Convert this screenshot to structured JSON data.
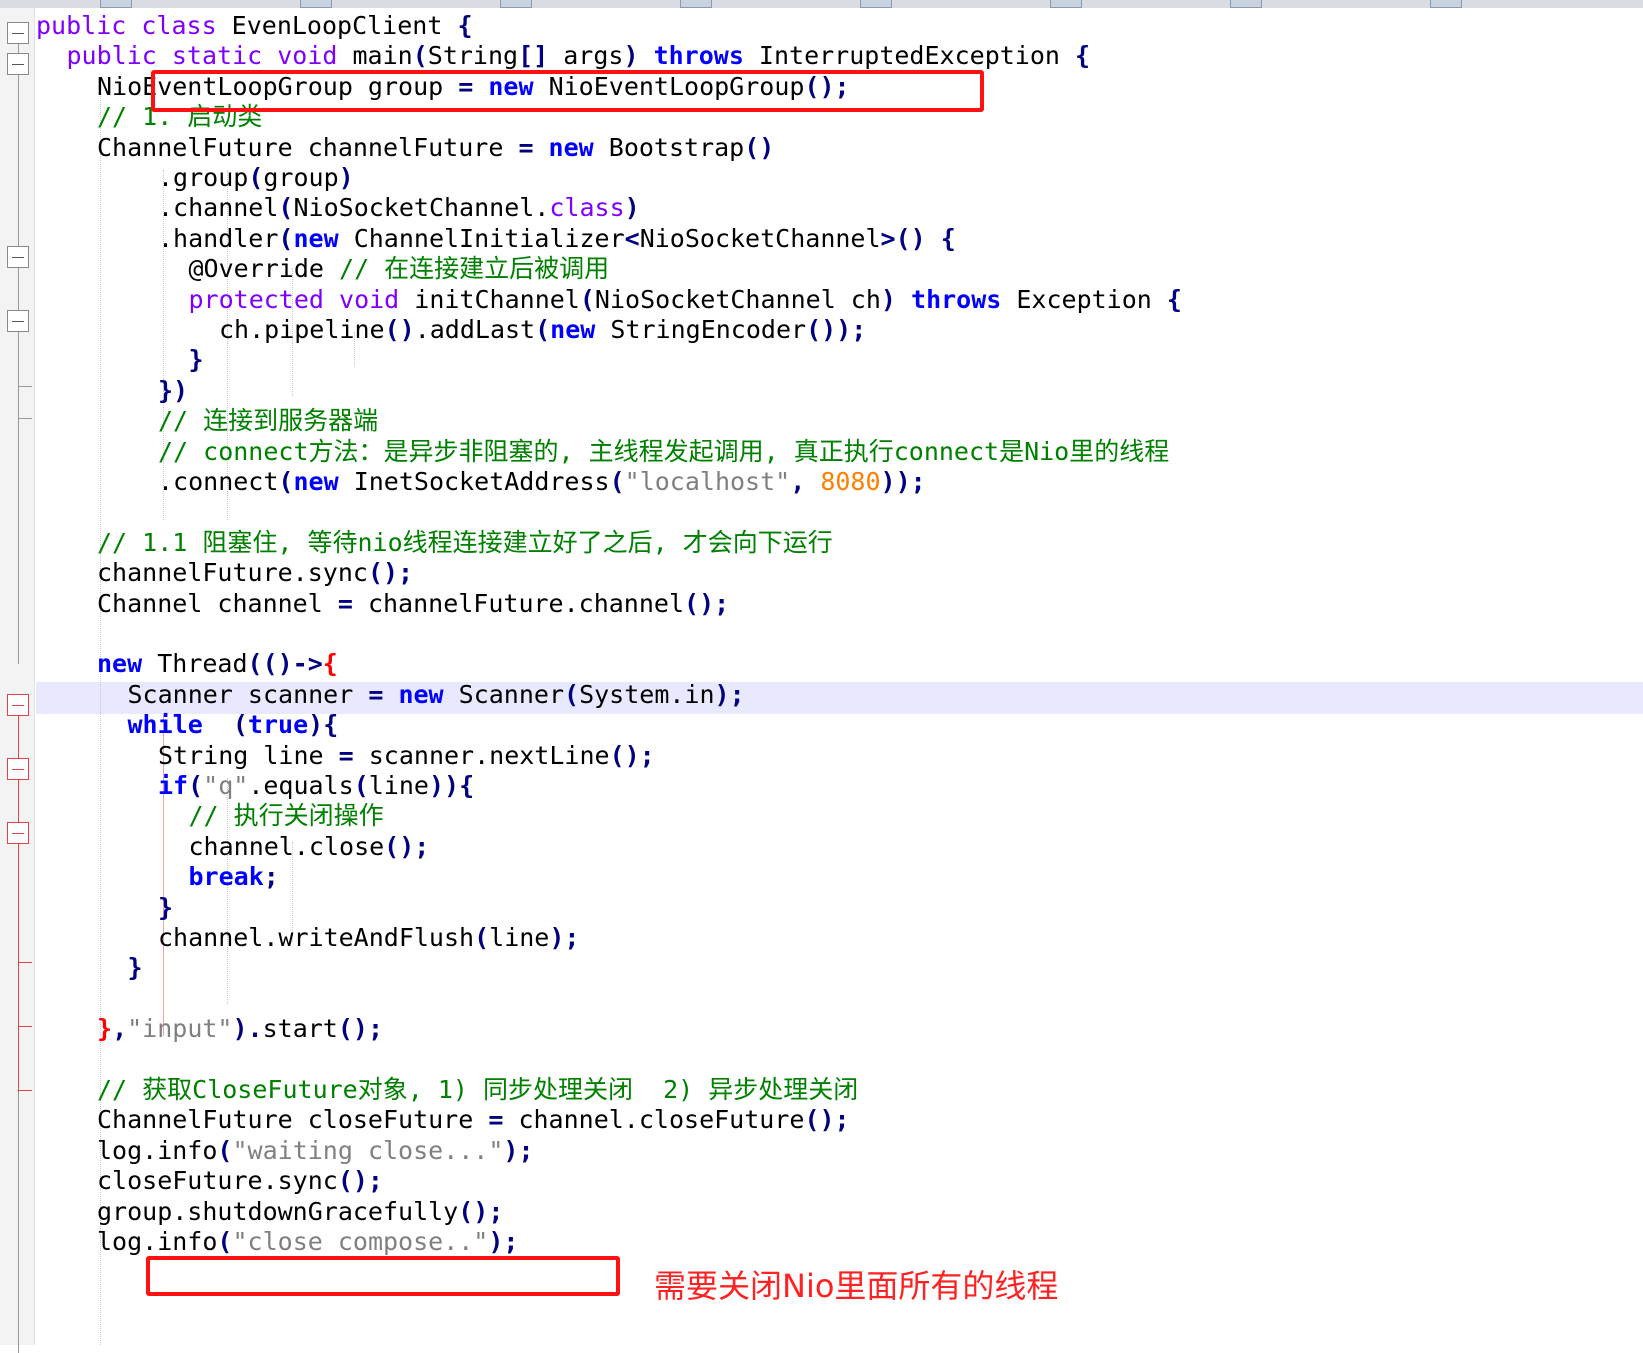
{
  "editor": {
    "language": "Java",
    "highlighted_line": 22,
    "lines": [
      [
        [
          "pk",
          "public class "
        ],
        [
          "t",
          "EvenLoopClient "
        ],
        [
          "op",
          "{"
        ]
      ],
      [
        [
          "pk",
          "public static void "
        ],
        [
          "t",
          "main"
        ],
        [
          "op",
          "("
        ],
        [
          "t",
          "String"
        ],
        [
          "op",
          "[] "
        ],
        [
          "t",
          "args"
        ],
        [
          "op",
          ") "
        ],
        [
          "kw",
          "throws "
        ],
        [
          "t",
          "InterruptedException "
        ],
        [
          "op",
          "{"
        ]
      ],
      [
        [
          "t",
          "NioEventLoopGroup group "
        ],
        [
          "op",
          "= "
        ],
        [
          "kw",
          "new "
        ],
        [
          "t",
          "NioEventLoopGroup"
        ],
        [
          "op",
          "();"
        ]
      ],
      [
        [
          "cm",
          "// 1. 启动类"
        ]
      ],
      [
        [
          "t",
          "ChannelFuture channelFuture "
        ],
        [
          "op",
          "= "
        ],
        [
          "kw",
          "new "
        ],
        [
          "t",
          "Bootstrap"
        ],
        [
          "op",
          "()"
        ]
      ],
      [
        [
          "t",
          ".group"
        ],
        [
          "op",
          "("
        ],
        [
          "t",
          "group"
        ],
        [
          "op",
          ")"
        ]
      ],
      [
        [
          "t",
          ".channel"
        ],
        [
          "op",
          "("
        ],
        [
          "t",
          "NioSocketChannel."
        ],
        [
          "pk",
          "class"
        ],
        [
          "op",
          ")"
        ]
      ],
      [
        [
          "t",
          ".handler"
        ],
        [
          "op",
          "("
        ],
        [
          "kw",
          "new "
        ],
        [
          "t",
          "ChannelInitializer"
        ],
        [
          "op",
          "<"
        ],
        [
          "t",
          "NioSocketChannel"
        ],
        [
          "op",
          ">() {"
        ]
      ],
      [
        [
          "t",
          "@Override "
        ],
        [
          "cm",
          "// 在连接建立后被调用"
        ]
      ],
      [
        [
          "pk",
          "protected void "
        ],
        [
          "t",
          "initChannel"
        ],
        [
          "op",
          "("
        ],
        [
          "t",
          "NioSocketChannel ch"
        ],
        [
          "op",
          ") "
        ],
        [
          "kw",
          "throws "
        ],
        [
          "t",
          "Exception "
        ],
        [
          "op",
          "{"
        ]
      ],
      [
        [
          "t",
          "ch.pipeline"
        ],
        [
          "op",
          "()"
        ],
        [
          "t",
          ".addLast"
        ],
        [
          "op",
          "("
        ],
        [
          "kw",
          "new "
        ],
        [
          "t",
          "StringEncoder"
        ],
        [
          "op",
          "());"
        ]
      ],
      [
        [
          "op",
          "}"
        ]
      ],
      [
        [
          "op",
          "})"
        ]
      ],
      [
        [
          "cm",
          "// 连接到服务器端"
        ]
      ],
      [
        [
          "cm",
          "// connect方法：是异步非阻塞的, 主线程发起调用, 真正执行connect是Nio里的线程"
        ]
      ],
      [
        [
          "t",
          ".connect"
        ],
        [
          "op",
          "("
        ],
        [
          "kw",
          "new "
        ],
        [
          "t",
          "InetSocketAddress"
        ],
        [
          "op",
          "("
        ],
        [
          "st",
          "\"localhost\""
        ],
        [
          "op",
          ", "
        ],
        [
          "nm",
          "8080"
        ],
        [
          "op",
          "));"
        ]
      ],
      [],
      [
        [
          "cm",
          "// 1.1 阻塞住, 等待nio线程连接建立好了之后, 才会向下运行"
        ]
      ],
      [
        [
          "t",
          "channelFuture.sync"
        ],
        [
          "op",
          "();"
        ]
      ],
      [
        [
          "t",
          "Channel channel "
        ],
        [
          "op",
          "= "
        ],
        [
          "t",
          "channelFuture.channel"
        ],
        [
          "op",
          "();"
        ]
      ],
      [],
      [
        [
          "kw",
          "new "
        ],
        [
          "t",
          "Thread"
        ],
        [
          "op",
          "(()->"
        ],
        [
          "rb",
          "{"
        ]
      ],
      [
        [
          "t",
          "Scanner scanner "
        ],
        [
          "op",
          "= "
        ],
        [
          "kw",
          "new "
        ],
        [
          "t",
          "Scanner"
        ],
        [
          "op",
          "("
        ],
        [
          "t",
          "System.in"
        ],
        [
          "op",
          ");"
        ]
      ],
      [
        [
          "kw",
          "while  "
        ],
        [
          "op",
          "("
        ],
        [
          "kw",
          "true"
        ],
        [
          "op",
          "){"
        ]
      ],
      [
        [
          "t",
          "String line "
        ],
        [
          "op",
          "= "
        ],
        [
          "t",
          "scanner.nextLine"
        ],
        [
          "op",
          "();"
        ]
      ],
      [
        [
          "kw",
          "if"
        ],
        [
          "op",
          "("
        ],
        [
          "st",
          "\"q\""
        ],
        [
          "t",
          ".equals"
        ],
        [
          "op",
          "("
        ],
        [
          "t",
          "line"
        ],
        [
          "op",
          ")){"
        ]
      ],
      [
        [
          "cm",
          "// 执行关闭操作"
        ]
      ],
      [
        [
          "t",
          "channel.close"
        ],
        [
          "op",
          "();"
        ]
      ],
      [
        [
          "kw",
          "break"
        ],
        [
          "op",
          ";"
        ]
      ],
      [
        [
          "op",
          "}"
        ]
      ],
      [
        [
          "t",
          "channel.writeAndFlush"
        ],
        [
          "op",
          "("
        ],
        [
          "t",
          "line"
        ],
        [
          "op",
          ");"
        ]
      ],
      [
        [
          "op",
          "}"
        ]
      ],
      [],
      [
        [
          "rb",
          "}"
        ],
        [
          "op",
          ","
        ],
        [
          "st",
          "\"input\""
        ],
        [
          "op",
          ")."
        ],
        [
          "t",
          "start"
        ],
        [
          "op",
          "();"
        ]
      ],
      [],
      [
        [
          "cm",
          "// 获取CloseFuture对象, 1) 同步处理关闭  2) 异步处理关闭"
        ]
      ],
      [
        [
          "t",
          "ChannelFuture closeFuture "
        ],
        [
          "op",
          "= "
        ],
        [
          "t",
          "channel.closeFuture"
        ],
        [
          "op",
          "();"
        ]
      ],
      [
        [
          "t",
          "log.info"
        ],
        [
          "op",
          "("
        ],
        [
          "st",
          "\"waiting close...\""
        ],
        [
          "op",
          ");"
        ]
      ],
      [
        [
          "t",
          "closeFuture.sync"
        ],
        [
          "op",
          "();"
        ]
      ],
      [
        [
          "t",
          "group.shutdownGracefully"
        ],
        [
          "op",
          "();"
        ]
      ],
      [
        [
          "t",
          "log.info"
        ],
        [
          "op",
          "("
        ],
        [
          "st",
          "\"close compose..\""
        ],
        [
          "op",
          ");"
        ]
      ]
    ]
  },
  "annotation": {
    "text": "需要关闭Nio里面所有的线程",
    "color": "#ff2222"
  },
  "highlight_boxes": [
    {
      "name": "highlight-box-group-creation",
      "line": 2
    },
    {
      "name": "highlight-box-shutdown",
      "line": 39
    }
  ],
  "colors": {
    "keyword": "#0000ff",
    "modifier": "#8000ff",
    "comment": "#008000",
    "string": "#808080",
    "number": "#ff8000",
    "operator": "#000080",
    "box": "#ff1111"
  }
}
